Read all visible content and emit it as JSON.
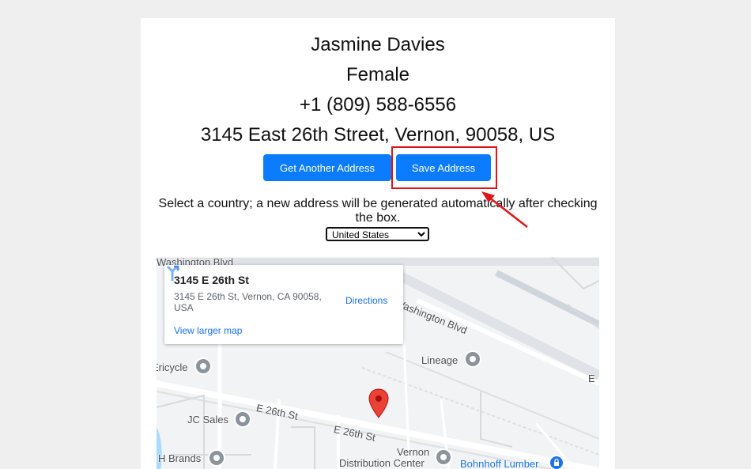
{
  "profile": {
    "name": "Jasmine Davies",
    "gender": "Female",
    "phone": "+1 (809) 588-6556",
    "address": "3145 East 26th Street, Vernon, 90058, US"
  },
  "buttons": {
    "get_another": "Get Another Address",
    "save": "Save Address"
  },
  "instructions": "Select a country; a new address will be generated automatically after checking the box.",
  "country_select": {
    "selected": "United States"
  },
  "map": {
    "info_card": {
      "title": "3145 E 26th St",
      "address": "3145 E 26th St, Vernon, CA 90058, USA",
      "directions_label": "Directions",
      "larger_map_link": "View larger map"
    },
    "labels": {
      "washington_top": "Washington Blvd",
      "washington_right": "Washington Blvd",
      "ericycle": "Ericycle",
      "lineage": "Lineage",
      "jc_sales": "JC Sales",
      "e26_left": "E 26th St",
      "e26_center": "E 26th St",
      "vernon_dc_1": "Vernon",
      "vernon_dc_2": "Distribution Center",
      "h_brands": "H Brands",
      "bohnhoff": "Bohnhoff Lumber",
      "edge_e": "E"
    }
  },
  "colors": {
    "button": "#0b7cff",
    "highlight": "#e1141b",
    "pin": "#ea4335",
    "link": "#1a73e8"
  }
}
